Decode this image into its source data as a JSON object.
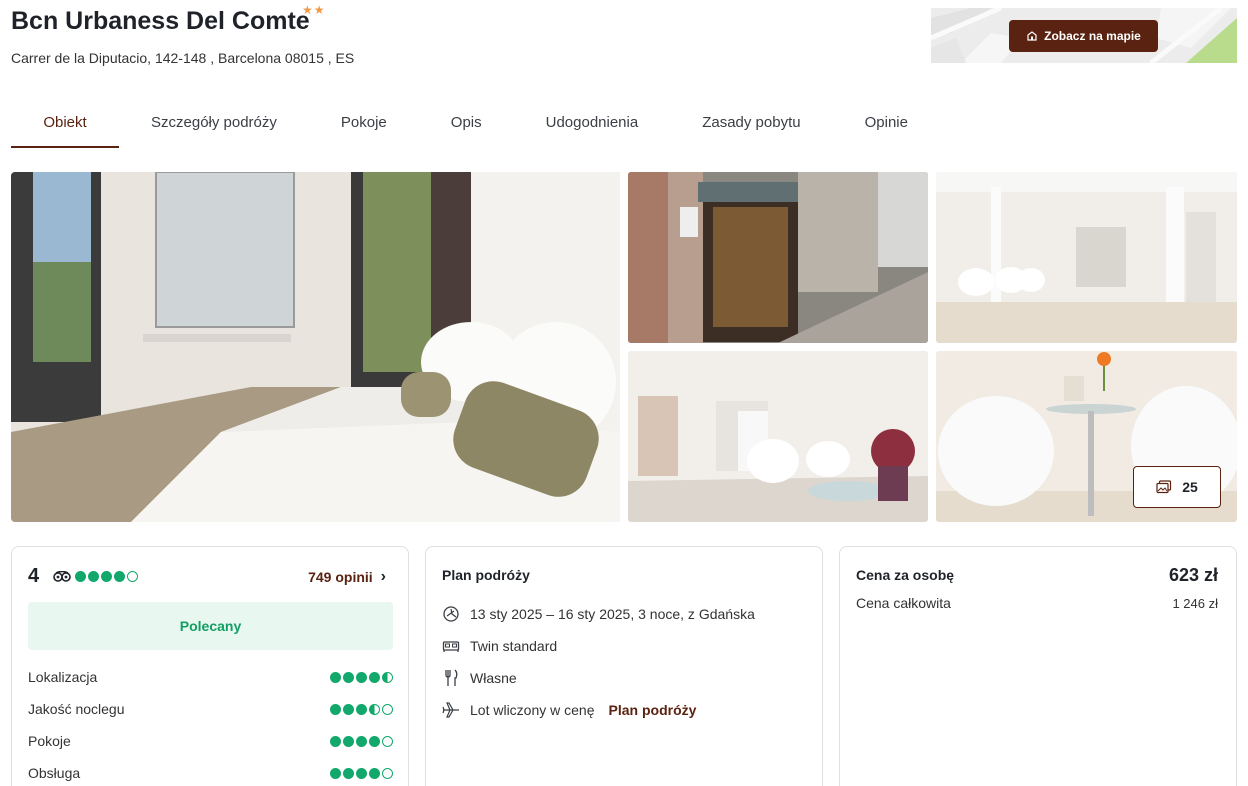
{
  "hotel": {
    "name": "Bcn Urbaness Del Comte",
    "stars": "★★",
    "address": "Carrer de la Diputacio, 142-148 , Barcelona 08015 , ES"
  },
  "map": {
    "button_label": "Zobacz na mapie",
    "icon": "house-pin-icon"
  },
  "tabs": [
    {
      "label": "Obiekt",
      "active": true
    },
    {
      "label": "Szczegóły podróży"
    },
    {
      "label": "Pokoje"
    },
    {
      "label": "Opis"
    },
    {
      "label": "Udogodnienia"
    },
    {
      "label": "Zasady pobytu"
    },
    {
      "label": "Opinie"
    }
  ],
  "gallery": {
    "photo_count": "25",
    "icon": "gallery-icon"
  },
  "rating": {
    "score": "4",
    "score_dots": 4,
    "reviews_label": "749 opinii",
    "badge": "Polecany",
    "items": [
      {
        "label": "Lokalizacja",
        "value": 4.5
      },
      {
        "label": "Jakość noclegu",
        "value": 3.5
      },
      {
        "label": "Pokoje",
        "value": 4
      },
      {
        "label": "Obsługa",
        "value": 4
      }
    ]
  },
  "plan": {
    "title": "Plan podróży",
    "dates": "13 sty 2025 – 16 sty 2025, 3 noce, z Gdańska",
    "room": "Twin standard",
    "board": "Własne",
    "flight": "Lot wliczony w cenę",
    "flight_link": "Plan podróży"
  },
  "price": {
    "per_person_label": "Cena za osobę",
    "per_person_value": "623 zł",
    "total_label": "Cena całkowita",
    "total_value": "1 246 zł"
  },
  "colors": {
    "brand": "#5a2210",
    "rating_green": "#12a86b",
    "star": "#f2994a"
  }
}
